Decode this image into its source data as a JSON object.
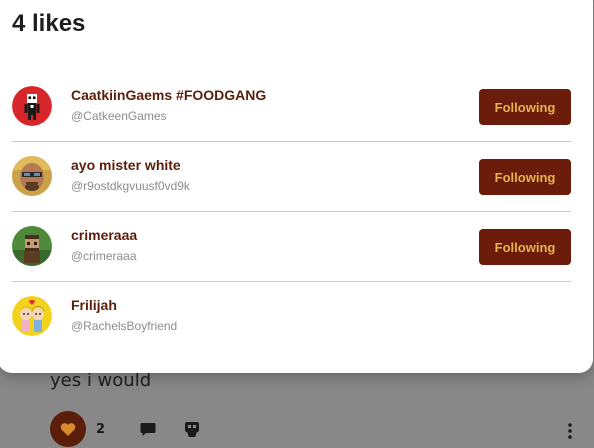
{
  "colors": {
    "brand": "#6b1c0a",
    "button_text": "#e8b24c",
    "name_text": "#5a1e0a",
    "handle_text": "#8c8c8c",
    "overlay": "#888888"
  },
  "modal": {
    "title": "4 likes",
    "users": [
      {
        "name": "CaatkiinGaems #FOODGANG",
        "handle": "@CatkeenGames",
        "button": "Following",
        "avatar_icon": "red-character-avatar"
      },
      {
        "name": "ayo mister white",
        "handle": "@r9ostdkgvuusf0vd9k",
        "button": "Following",
        "avatar_icon": "bald-man-avatar"
      },
      {
        "name": "crimeraaa",
        "handle": "@crimeraaa",
        "button": "Following",
        "avatar_icon": "pixel-character-avatar"
      },
      {
        "name": "Frilijah",
        "handle": "@RachelsBoyfriend",
        "button": "",
        "avatar_icon": "couple-drawing-avatar"
      }
    ]
  },
  "background_post": {
    "text": "yes i would",
    "like_count": "2"
  }
}
